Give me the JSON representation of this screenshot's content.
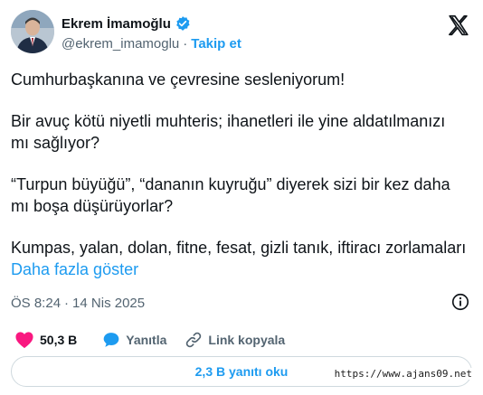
{
  "author": {
    "name": "Ekrem İmamoğlu",
    "handle": "@ekrem_imamoglu",
    "separator": "·",
    "follow_label": "Takip et"
  },
  "tweet": {
    "lines": [
      "Cumhurbaşkanına ve çevresine sesleniyorum!",
      "Bir avuç kötü niyetli muhteris; ihanetleri ile yine aldatılmanızı mı sağlıyor?",
      "“Turpun büyüğü”, “dananın kuyruğu” diyerek sizi bir kez daha mı boşa düşürüyorlar?",
      "Kumpas, yalan, dolan, fitne, fesat, gizli tanık, iftiracı zorlamaları"
    ],
    "show_more_label": "Daha fazla göster"
  },
  "meta": {
    "time": "ÖS 8:24",
    "separator": "·",
    "date": "14 Nis 2025"
  },
  "actions": {
    "like_count": "50,3 B",
    "reply_label": "Yanıtla",
    "copy_link_label": "Link kopyala"
  },
  "replies_button_label": "2,3 B yanıtı oku",
  "watermark": "https://www.ajans09.net",
  "colors": {
    "accent": "#1d9bf0",
    "like": "#f91880",
    "text": "#0f1419",
    "muted": "#536471",
    "border": "#cfd9de"
  },
  "icons": [
    "avatar",
    "verified-badge-icon",
    "x-logo-icon",
    "info-icon",
    "heart-icon",
    "reply-bubble-icon",
    "link-icon"
  ]
}
